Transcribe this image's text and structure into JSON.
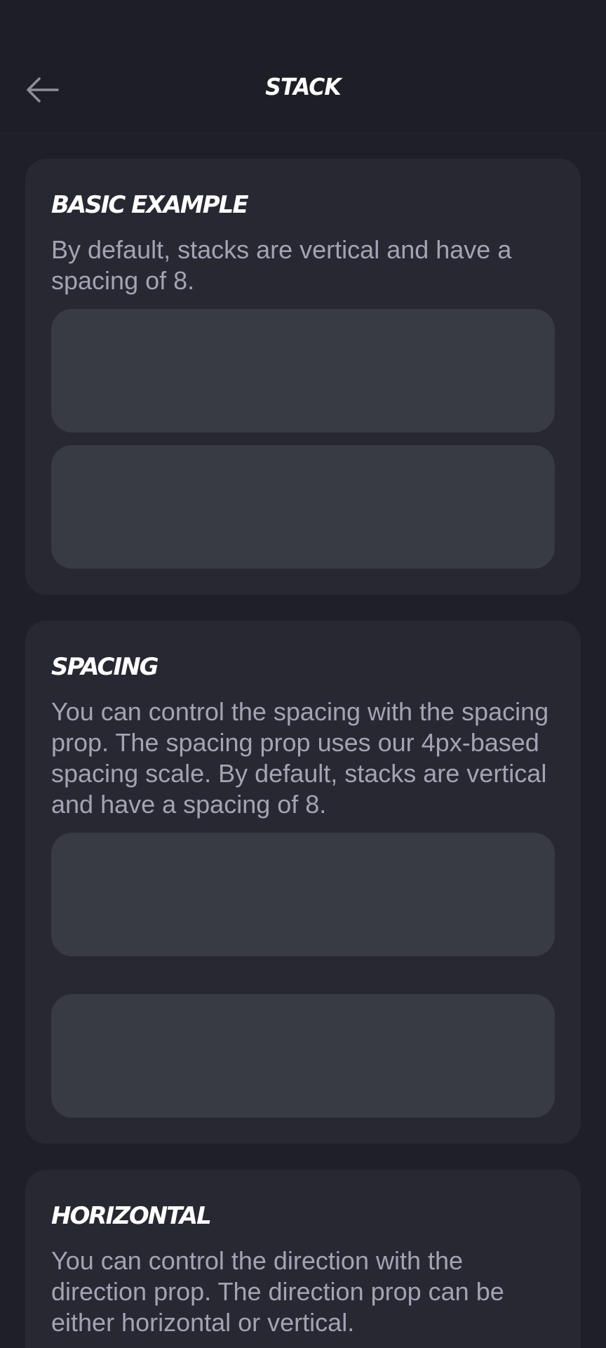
{
  "header": {
    "title": "STACK",
    "back_icon": "arrow-left-icon"
  },
  "sections": [
    {
      "title": "BASIC EXAMPLE",
      "description": "By default, stacks are vertical and have a spacing of 8."
    },
    {
      "title": "SPACING",
      "description": "You can control the spacing with the spacing prop. The spacing prop uses our 4px-based spacing scale. By default, stacks are vertical and have a spacing of 8."
    },
    {
      "title": "HORIZONTAL",
      "description": "You can control the direction with the direction prop. The direction prop can be either horizontal or vertical."
    }
  ],
  "colors": {
    "background": "#1f1f27",
    "card": "#272832",
    "stack_item": "#383a44",
    "text_primary": "#ffffff",
    "text_secondary": "#a2a4b2"
  }
}
